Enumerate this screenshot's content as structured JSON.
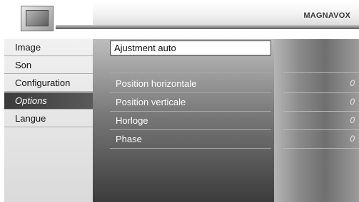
{
  "header": {
    "brand": "MAGNAVOX",
    "icon": "tv-monitor-icon"
  },
  "menu": {
    "items": [
      {
        "label": "Image"
      },
      {
        "label": "Son"
      },
      {
        "label": "Configuration"
      },
      {
        "label": "Options",
        "active": true
      },
      {
        "label": "Langue"
      }
    ]
  },
  "options": {
    "auto_adjust": "Ajustment auto",
    "params": [
      {
        "label": "Position horizontale",
        "value": "0"
      },
      {
        "label": "Position verticale",
        "value": "0"
      },
      {
        "label": "Horloge",
        "value": "0"
      },
      {
        "label": "Phase",
        "value": "0"
      }
    ]
  }
}
